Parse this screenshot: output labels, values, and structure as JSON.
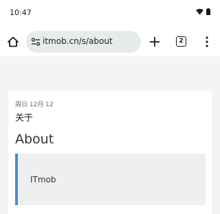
{
  "status_bar": {
    "time": "10:47",
    "icons": [
      "wifi-icon",
      "battery-icon"
    ]
  },
  "browser": {
    "url": "itmob.cn/s/about",
    "tab_count": "2",
    "icons": [
      "home-icon",
      "tune-icon",
      "plus-icon",
      "more-vert-icon"
    ]
  },
  "post": {
    "date": "周日 12月 12",
    "title": "关于",
    "heading": "About",
    "quote": "ITmob"
  },
  "colors": {
    "accent": "#4f86e0",
    "omnibox": "#e6ecec",
    "page_background": "#f3f4f3"
  }
}
